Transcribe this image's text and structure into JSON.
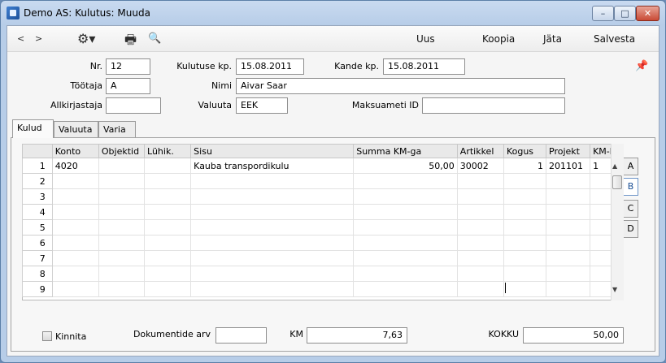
{
  "window": {
    "title": "Demo AS: Kulutus: Muuda",
    "min_label": "–",
    "max_label": "□",
    "close_label": "✕"
  },
  "toolbar": {
    "back_label": "<",
    "forward_label": ">",
    "gear_label": "⚙▾",
    "print_label": "🖶",
    "preview_label": "🔍",
    "new_label": "Uus",
    "copy_label": "Koopia",
    "skip_label": "Jäta",
    "save_label": "Salvesta"
  },
  "header": {
    "nr_label": "Nr.",
    "nr_value": "12",
    "date_label": "Kulutuse kp.",
    "date_value": "15.08.2011",
    "trans_date_label": "Kande kp.",
    "trans_date_value": "15.08.2011",
    "employee_label": "Töötaja",
    "employee_value": "A",
    "name_label": "Nimi",
    "name_value": "Aivar Saar",
    "signer_label": "Allkirjastaja",
    "signer_value": "",
    "currency_label": "Valuuta",
    "currency_value": "EEK",
    "payment_label": "Maksuameti ID",
    "payment_value": "",
    "pin_icon": "📌"
  },
  "tabs": [
    {
      "label": "Kulud"
    },
    {
      "label": "Valuuta"
    },
    {
      "label": "Varia"
    }
  ],
  "grid": {
    "columns": [
      "",
      "Konto",
      "Objektid",
      "Lühik.",
      "Sisu",
      "Summa KM-ga",
      "Artikkel",
      "Kogus",
      "Projekt",
      "KM-k"
    ],
    "rows": [
      {
        "n": "1",
        "konto": "4020",
        "objektid": "",
        "luhik": "",
        "sisu": "Kauba transpordikulu",
        "summa": "50,00",
        "artikkel": "30002",
        "kogus": "1",
        "projekt": "201101",
        "kmk": "1"
      },
      {
        "n": "2",
        "konto": "",
        "objektid": "",
        "luhik": "",
        "sisu": "",
        "summa": "",
        "artikkel": "",
        "kogus": "",
        "projekt": "",
        "kmk": ""
      },
      {
        "n": "3",
        "konto": "",
        "objektid": "",
        "luhik": "",
        "sisu": "",
        "summa": "",
        "artikkel": "",
        "kogus": "",
        "projekt": "",
        "kmk": ""
      },
      {
        "n": "4",
        "konto": "",
        "objektid": "",
        "luhik": "",
        "sisu": "",
        "summa": "",
        "artikkel": "",
        "kogus": "",
        "projekt": "",
        "kmk": ""
      },
      {
        "n": "5",
        "konto": "",
        "objektid": "",
        "luhik": "",
        "sisu": "",
        "summa": "",
        "artikkel": "",
        "kogus": "",
        "projekt": "",
        "kmk": ""
      },
      {
        "n": "6",
        "konto": "",
        "objektid": "",
        "luhik": "",
        "sisu": "",
        "summa": "",
        "artikkel": "",
        "kogus": "",
        "projekt": "",
        "kmk": ""
      },
      {
        "n": "7",
        "konto": "",
        "objektid": "",
        "luhik": "",
        "sisu": "",
        "summa": "",
        "artikkel": "",
        "kogus": "",
        "projekt": "",
        "kmk": ""
      },
      {
        "n": "8",
        "konto": "",
        "objektid": "",
        "luhik": "",
        "sisu": "",
        "summa": "",
        "artikkel": "",
        "kogus": "",
        "projekt": "",
        "kmk": ""
      },
      {
        "n": "9",
        "konto": "",
        "objektid": "",
        "luhik": "",
        "sisu": "",
        "summa": "",
        "artikkel": "",
        "kogus": "",
        "projekt": "",
        "kmk": ""
      }
    ],
    "scroll_up": "▲",
    "scroll_down": "▼"
  },
  "side_buttons": [
    "A",
    "B",
    "C",
    "D"
  ],
  "footer": {
    "approve_label": "Kinnita",
    "doc_count_label": "Dokumentide arv",
    "doc_count_value": "",
    "vat_label": "KM",
    "vat_value": "7,63",
    "total_label": "KOKKU",
    "total_value": "50,00"
  }
}
